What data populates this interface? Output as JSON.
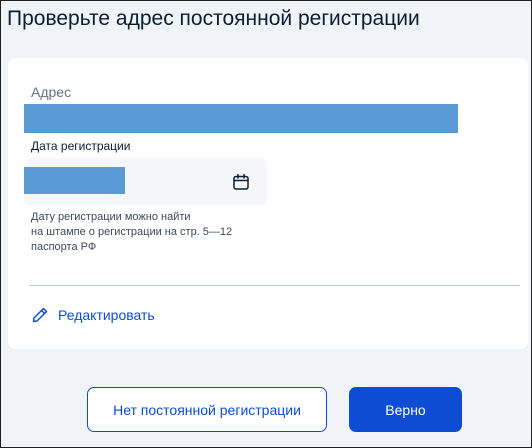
{
  "page": {
    "title": "Проверьте адрес постоянной регистрации"
  },
  "card": {
    "address_label": "Адрес",
    "date_label": "Дата регистрации",
    "hint_lines": [
      "Дату регистрации можно найти",
      "на штампе о регистрации на стр. 5—12",
      "паспорта РФ"
    ],
    "edit_label": "Редактировать"
  },
  "actions": {
    "no_registration_label": "Нет постоянной регистрации",
    "confirm_label": "Верно"
  },
  "icons": {
    "calendar": "calendar-icon",
    "edit": "pencil-icon"
  },
  "colors": {
    "accent": "#0d4cd3",
    "redaction": "#5b9bd5",
    "background": "#f0f3f7"
  }
}
